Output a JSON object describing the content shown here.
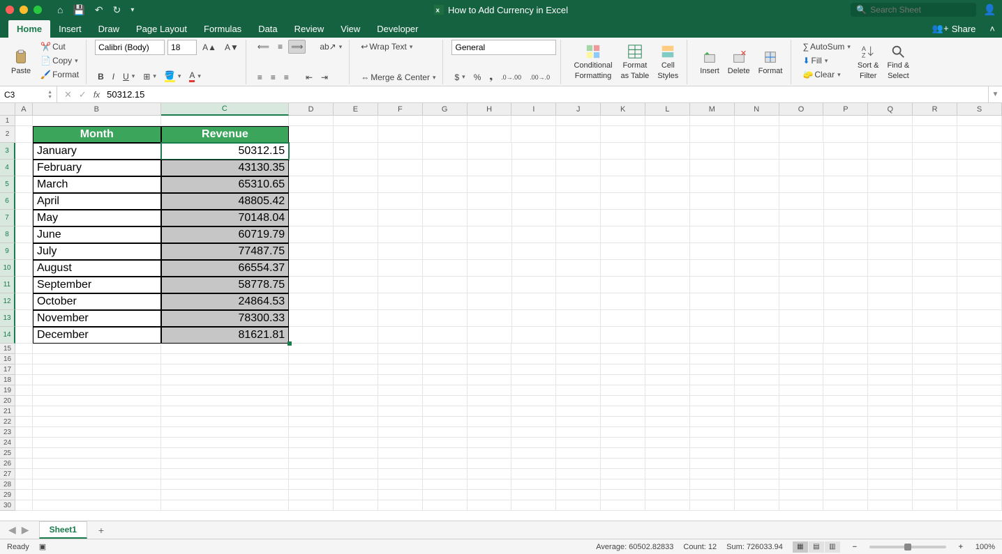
{
  "title": "How to Add Currency in Excel",
  "search_placeholder": "Search Sheet",
  "tabs": [
    "Home",
    "Insert",
    "Draw",
    "Page Layout",
    "Formulas",
    "Data",
    "Review",
    "View",
    "Developer"
  ],
  "share": "Share",
  "clipboard": {
    "paste": "Paste",
    "cut": "Cut",
    "copy": "Copy",
    "format": "Format"
  },
  "font": {
    "name": "Calibri (Body)",
    "size": "18"
  },
  "alignment": {
    "wrap": "Wrap Text",
    "merge": "Merge & Center"
  },
  "number": {
    "format": "General"
  },
  "styles": {
    "cond": "Conditional",
    "cond2": "Formatting",
    "fat": "Format",
    "fat2": "as Table",
    "cell": "Cell",
    "cell2": "Styles"
  },
  "cellops": {
    "insert": "Insert",
    "delete": "Delete",
    "format": "Format"
  },
  "editing": {
    "autosum": "AutoSum",
    "fill": "Fill",
    "clear": "Clear",
    "sort": "Sort &",
    "sort2": "Filter",
    "find": "Find &",
    "find2": "Select"
  },
  "namebox": "C3",
  "formula": "50312.15",
  "columns": [
    "A",
    "B",
    "C",
    "D",
    "E",
    "F",
    "G",
    "H",
    "I",
    "J",
    "K",
    "L",
    "M",
    "N",
    "O",
    "P",
    "Q",
    "R",
    "S"
  ],
  "headers": {
    "month": "Month",
    "rev": "Revenue"
  },
  "rows": [
    {
      "m": "January",
      "r": "50312.15"
    },
    {
      "m": "February",
      "r": "43130.35"
    },
    {
      "m": "March",
      "r": "65310.65"
    },
    {
      "m": "April",
      "r": "48805.42"
    },
    {
      "m": "May",
      "r": "70148.04"
    },
    {
      "m": "June",
      "r": "60719.79"
    },
    {
      "m": "July",
      "r": "77487.75"
    },
    {
      "m": "August",
      "r": "66554.37"
    },
    {
      "m": "September",
      "r": "58778.75"
    },
    {
      "m": "October",
      "r": "24864.53"
    },
    {
      "m": "November",
      "r": "78300.33"
    },
    {
      "m": "December",
      "r": "81621.81"
    }
  ],
  "sheet": "Sheet1",
  "status": {
    "ready": "Ready",
    "avg": "Average: 60502.82833",
    "count": "Count: 12",
    "sum": "Sum: 726033.94",
    "zoom": "100%"
  }
}
